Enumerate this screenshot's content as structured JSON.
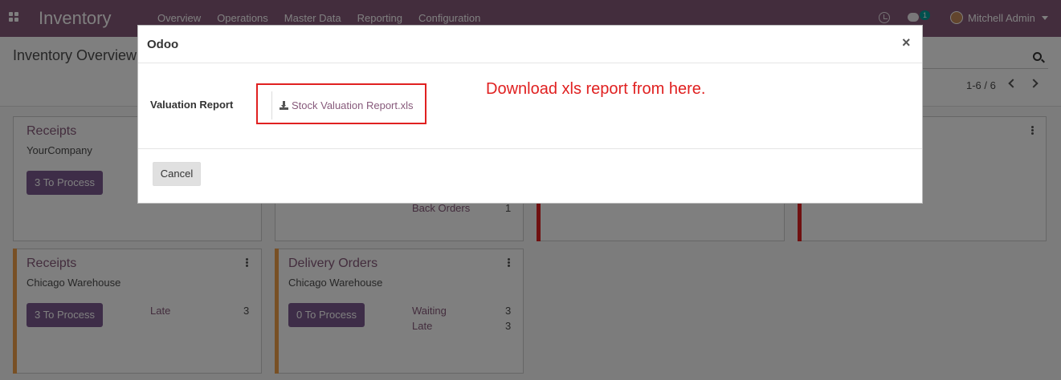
{
  "navbar": {
    "app_title": "Inventory",
    "menu": [
      "Overview",
      "Operations",
      "Master Data",
      "Reporting",
      "Configuration"
    ],
    "chat_count": "1",
    "user_name": "Mitchell Admin"
  },
  "control_panel": {
    "page_title": "Inventory Overview",
    "pager": "1-6 / 6"
  },
  "cards": [
    {
      "title": "Receipts",
      "subtitle": "YourCompany",
      "button": "3 To Process"
    },
    {
      "stat_label": "Back Orders",
      "stat_value": "1"
    },
    {
      "title": "Receipts",
      "subtitle": "Chicago Warehouse",
      "button": "3 To Process",
      "stats": [
        {
          "label": "Late",
          "value": "3"
        }
      ]
    },
    {
      "title": "Delivery Orders",
      "subtitle": "Chicago Warehouse",
      "button": "0 To Process",
      "stats": [
        {
          "label": "Waiting",
          "value": "3"
        },
        {
          "label": "Late",
          "value": "3"
        }
      ]
    }
  ],
  "colors": {
    "brand": "#875a7b",
    "late_accent": "#f0a04b",
    "danger_accent": "#e02020",
    "button": "#7c5b91"
  },
  "modal": {
    "title": "Odoo",
    "close": "×",
    "field_label": "Valuation Report",
    "file_name": "Stock Valuation Report.xls",
    "annotation": "Download xls report from here.",
    "cancel_label": "Cancel"
  }
}
